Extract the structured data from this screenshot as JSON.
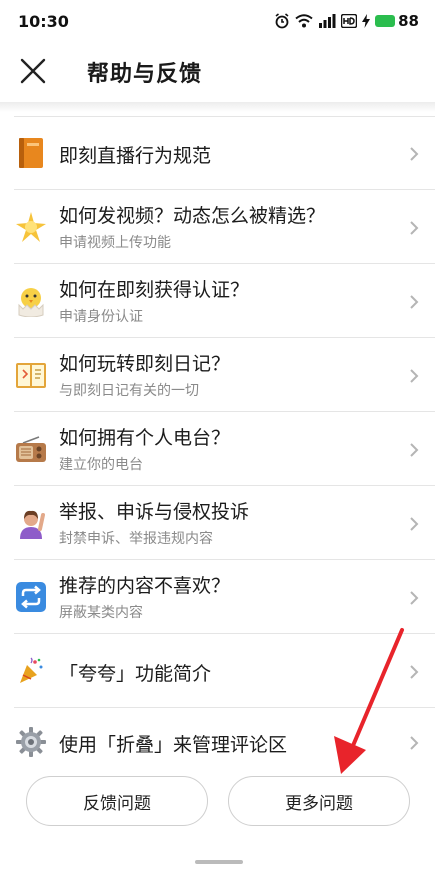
{
  "status_bar": {
    "time": "10:30",
    "battery": "88",
    "battery_color": "#2bbd4e"
  },
  "header": {
    "close_icon": "close-icon",
    "title": "帮助与反馈"
  },
  "items": [
    {
      "title": "即刻直播行为规范",
      "subtitle": "",
      "icon": "orange-book-icon"
    },
    {
      "title": "如何发视频？动态怎么被精选？",
      "subtitle": "申请视频上传功能",
      "icon": "sparkle-star-icon"
    },
    {
      "title": "如何在即刻获得认证？",
      "subtitle": "申请身份认证",
      "icon": "hatching-chick-icon"
    },
    {
      "title": "如何玩转即刻日记？",
      "subtitle": "与即刻日记有关的一切",
      "icon": "open-notebook-icon"
    },
    {
      "title": "如何拥有个人电台？",
      "subtitle": "建立你的电台",
      "icon": "radio-icon"
    },
    {
      "title": "举报、申诉与侵权投诉",
      "subtitle": "封禁申诉、举报违规内容",
      "icon": "raising-hand-person-icon"
    },
    {
      "title": "推荐的内容不喜欢？",
      "subtitle": "屏蔽某类内容",
      "icon": "repeat-arrows-icon"
    },
    {
      "title": "「夸夸」功能简介",
      "subtitle": "",
      "icon": "party-popper-icon"
    },
    {
      "title": "使用「折叠」来管理评论区",
      "subtitle": "",
      "icon": "gear-icon"
    }
  ],
  "bottom": {
    "feedback_label": "反馈问题",
    "more_label": "更多问题"
  },
  "annotation": {
    "arrow_color": "#e8242b"
  }
}
